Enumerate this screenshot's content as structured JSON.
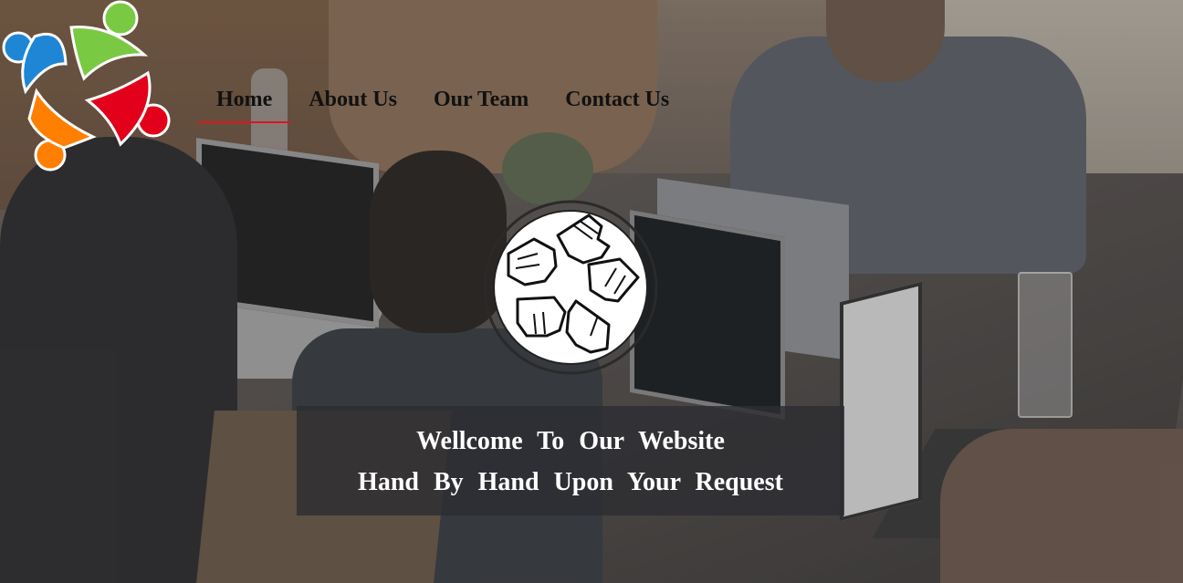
{
  "nav": {
    "items": [
      {
        "label": "Home",
        "active": true
      },
      {
        "label": "About Us",
        "active": false
      },
      {
        "label": "Our Team",
        "active": false
      },
      {
        "label": "Contact Us",
        "active": false
      }
    ],
    "active_underline_color": "#e0141e"
  },
  "logo": {
    "icon": "team-circle-logo-icon",
    "colors": [
      "#1f86d6",
      "#7ac943",
      "#e2001a",
      "#ff7f00"
    ]
  },
  "emblem": {
    "icon": "hands-together-icon"
  },
  "banner": {
    "line1": "Wellcome To Our Website",
    "line2": "Hand By Hand Upon Your Request"
  },
  "background": {
    "description_icon": "office-team-photo"
  }
}
